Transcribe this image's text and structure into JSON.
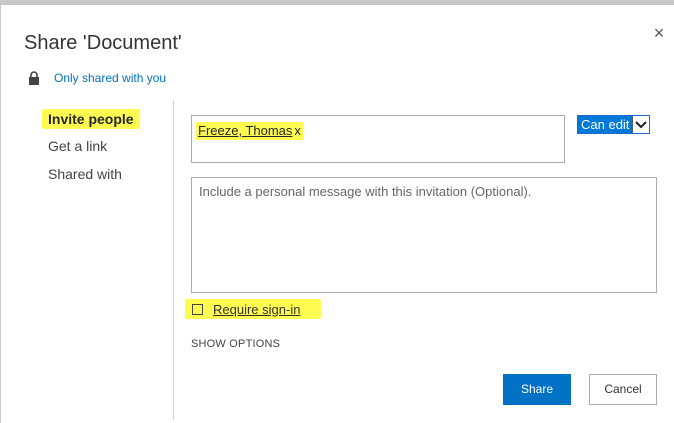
{
  "dialog": {
    "title": "Share 'Document'",
    "close_icon": "close-icon",
    "close_glyph": "×"
  },
  "sharing_status": {
    "icon": "lock-icon",
    "text": "Only shared with you"
  },
  "nav": {
    "items": [
      {
        "label": "Invite people",
        "active": true
      },
      {
        "label": "Get a link",
        "active": false
      },
      {
        "label": "Shared with",
        "active": false
      }
    ]
  },
  "invite": {
    "recipients": [
      {
        "name": "Freeze, Thomas",
        "remove_glyph": "x"
      }
    ],
    "permission": {
      "selected": "Can edit",
      "icon": "chevron-down-icon"
    }
  },
  "message": {
    "placeholder": "Include a personal message with this invitation (Optional)."
  },
  "require_signin": {
    "label": "Require sign-in",
    "checked": false
  },
  "show_options": {
    "label": "SHOW OPTIONS"
  },
  "buttons": {
    "share_label": "Share",
    "cancel_label": "Cancel"
  },
  "colors": {
    "accent": "#0072c6",
    "highlight": "#fffb50",
    "selected_dropdown": "#0078d7"
  }
}
